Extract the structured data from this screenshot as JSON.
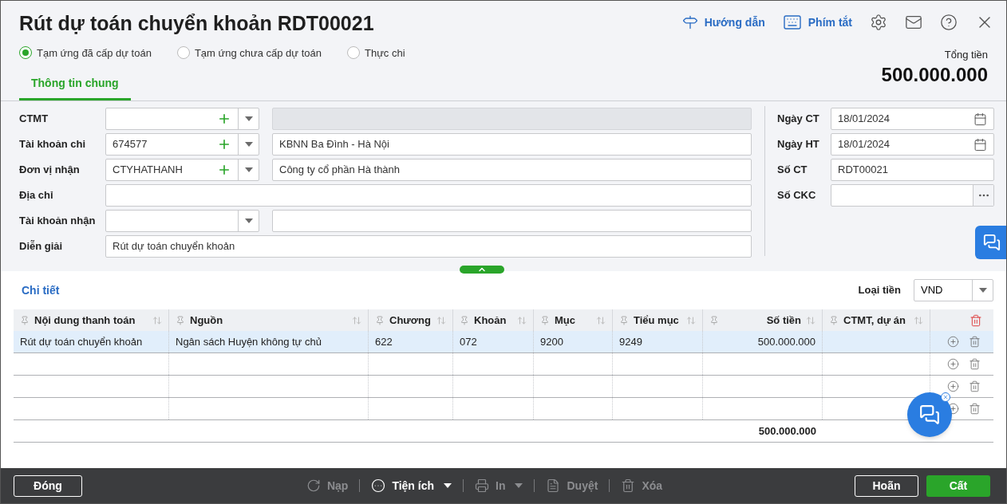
{
  "title": "Rút dự toán chuyển khoản RDT00021",
  "header_links": [
    {
      "kind": "guide",
      "label": "Hướng dẫn"
    },
    {
      "kind": "shortcuts",
      "label": "Phím tắt"
    }
  ],
  "modes": [
    {
      "label": "Tạm ứng đã cấp dự toán",
      "selected": true
    },
    {
      "label": "Tạm ứng chưa cấp dự toán",
      "selected": false
    },
    {
      "label": "Thực chi",
      "selected": false
    }
  ],
  "total": {
    "label": "Tổng tiền",
    "value": "500.000.000"
  },
  "tabs": [
    {
      "label": "Thông tin chung",
      "selected": true
    }
  ],
  "left_fields": [
    {
      "label": "CTMT",
      "kind": "combo_add",
      "description_disabled": true
    },
    {
      "label": "Tài khoản chi",
      "kind": "combo_add",
      "code": "674577",
      "description": "KBNN Ba Đình - Hà Nội",
      "description_disabled": false
    },
    {
      "label": "Đơn vị nhận",
      "kind": "combo_add",
      "code": "CTYHATHANH",
      "description": "Công ty cổ phần Hà thành",
      "description_disabled": false
    },
    {
      "label": "Địa chỉ",
      "kind": "text"
    },
    {
      "label": "Tài khoản nhận",
      "kind": "combo",
      "description_disabled": false
    },
    {
      "label": "Diễn giải",
      "kind": "text",
      "value": "Rút dự toán chuyển khoản"
    }
  ],
  "right_fields": [
    {
      "label": "Ngày CT",
      "kind": "date",
      "value": "18/01/2024"
    },
    {
      "label": "Ngày HT",
      "kind": "date",
      "value": "18/01/2024"
    },
    {
      "label": "Số CT",
      "kind": "text",
      "value": "RDT00021"
    },
    {
      "label": "Số CKC",
      "kind": "lookup"
    }
  ],
  "detail": {
    "title": "Chi tiết",
    "currency_label": "Loại tiền",
    "currency": "VND",
    "columns": [
      {
        "label": "Nội dung thanh toán"
      },
      {
        "label": "Nguồn"
      },
      {
        "label": "Chương"
      },
      {
        "label": "Khoản"
      },
      {
        "label": "Mục"
      },
      {
        "label": "Tiểu mục"
      },
      {
        "label": "Số tiền"
      },
      {
        "label": "CTMT, dự án"
      }
    ],
    "rows": [
      {
        "selected": true,
        "cells": [
          "Rút dự toán chuyển khoản",
          "Ngân sách Huyện không tự chủ",
          "622",
          "072",
          "9200",
          "9249",
          "500.000.000"
        ]
      }
    ],
    "total": "500.000.000"
  },
  "footer": {
    "close": "Đóng",
    "actions": [
      {
        "kind": "reload",
        "label": "Nạp",
        "disabled": true,
        "menu": false
      },
      {
        "kind": "utilities",
        "label": "Tiện ích",
        "disabled": false,
        "menu": true
      },
      {
        "kind": "print",
        "label": "In",
        "disabled": true,
        "menu": true
      },
      {
        "kind": "approve",
        "label": "Duyệt",
        "disabled": true,
        "menu": false
      },
      {
        "kind": "delete",
        "label": "Xóa",
        "disabled": true,
        "menu": false
      }
    ],
    "buttons": [
      {
        "label": "Hoãn",
        "primary": false
      },
      {
        "label": "Cất",
        "primary": true
      }
    ]
  }
}
